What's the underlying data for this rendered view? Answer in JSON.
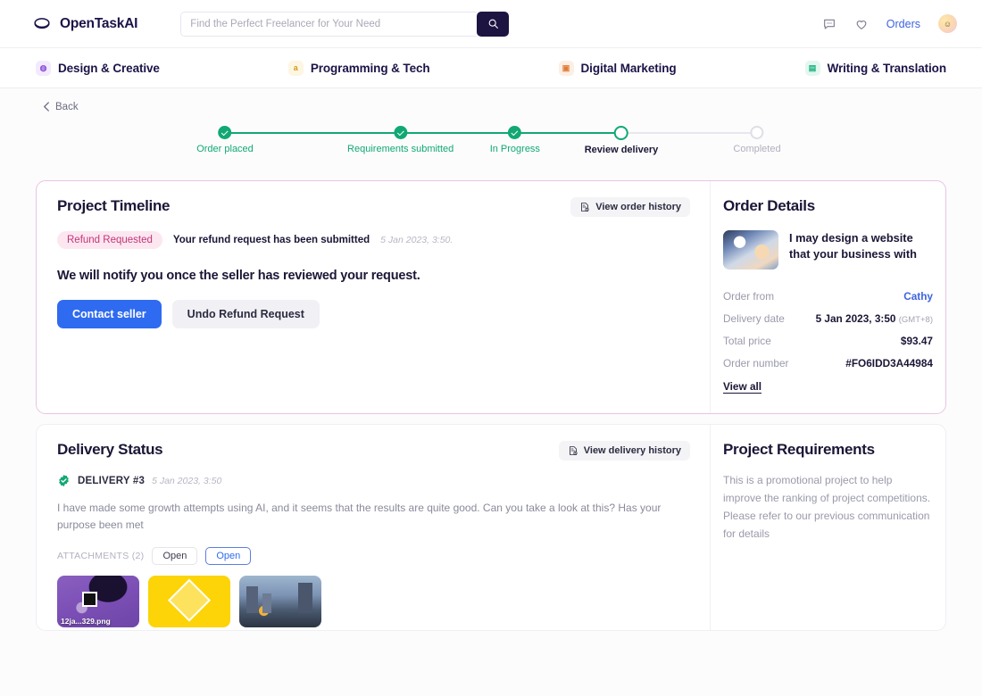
{
  "header": {
    "brand": "OpenTaskAI",
    "logo_icon": "disc-logo-icon",
    "search": {
      "placeholder": "Find the Perfect Freelancer for Your Need",
      "value": "",
      "button_icon": "search-icon",
      "button_color": "#1e1442"
    },
    "chat_icon": "chat-bubble-icon",
    "wishlist_icon": "heart-icon",
    "orders_label": "Orders",
    "orders_color": "#3d63df",
    "avatar_icon": "user-avatar-smiley"
  },
  "categories": [
    {
      "label": "Design & Creative",
      "icon": "palette-icon",
      "icon_bg": "#f3eafd",
      "icon_color": "#8a4fd8"
    },
    {
      "label": "Programming & Tech",
      "icon": "letter-a-icon",
      "icon_bg": "#fdf6e3",
      "icon_color": "#d19a18"
    },
    {
      "label": "Digital Marketing",
      "icon": "briefcase-icon",
      "icon_bg": "#fdeee3",
      "icon_color": "#e07a35"
    },
    {
      "label": "Writing & Translation",
      "icon": "document-lines-icon",
      "icon_bg": "#e3f7ef",
      "icon_color": "#17b07f"
    }
  ],
  "back_label": "Back",
  "stepper": {
    "active_color": "#11a873",
    "inactive_color": "#b0b0bd",
    "steps": [
      {
        "label": "Order placed",
        "state": "done"
      },
      {
        "label": "Requirements submitted",
        "state": "done"
      },
      {
        "label": "In Progress",
        "state": "done"
      },
      {
        "label": "Review delivery",
        "state": "current"
      },
      {
        "label": "Completed",
        "state": "todo"
      }
    ]
  },
  "timeline": {
    "title": "Project Timeline",
    "history_button": "View order history",
    "history_icon": "document-clock-icon",
    "status_badge": "Refund Requested",
    "status_badge_color": "#c2347a",
    "status_badge_bg": "#fce7f0",
    "status_message": "Your refund request has been submitted",
    "status_time": "5 Jan 2023, 3:50.",
    "note": "We will notify you once the seller has reviewed your request.",
    "primary_button": "Contact seller",
    "secondary_button": "Undo Refund Request"
  },
  "order_details": {
    "title": "Order Details",
    "product_thumb_icon": "product-artwork-thumbnail",
    "product_title": "I may design a website that your business with",
    "rows": [
      {
        "key": "Order from",
        "value": "Cathy",
        "link": true
      },
      {
        "key": "Delivery date",
        "value": "5 Jan 2023, 3:50",
        "suffix": "(GMT+8)"
      },
      {
        "key": "Total price",
        "value": "$93.47"
      },
      {
        "key": "Order number",
        "value": "#FO6IDD3A44984"
      }
    ],
    "view_all": "View all"
  },
  "delivery": {
    "title": "Delivery Status",
    "history_button": "View delivery history",
    "history_icon": "document-clock-icon",
    "badge_icon": "verified-check-icon",
    "delivery_no": "DELIVERY #3",
    "delivery_time": "5 Jan 2023, 3:50",
    "message": "I have made some growth attempts using AI, and it seems that the results are quite good. Can you take a look at this? Has your purpose been met",
    "attachments_label": "ATTACHMENTS (2)",
    "open_button": "Open",
    "open_button_active": "Open",
    "thumbs": [
      {
        "name": "attachment-thumb-purple",
        "filename": "12ja...329.png"
      },
      {
        "name": "attachment-thumb-yellow",
        "filename": ""
      },
      {
        "name": "attachment-thumb-city",
        "filename": ""
      }
    ]
  },
  "requirements": {
    "title": "Project Requirements",
    "text": "This is a promotional project to help improve the ranking of project competitions. Please refer to our previous communication for details"
  }
}
